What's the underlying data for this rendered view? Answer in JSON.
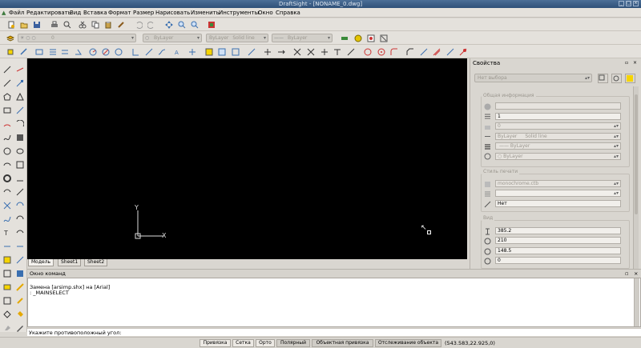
{
  "window": {
    "title": "DraftSight - [NONAME_0.dwg]"
  },
  "menu": [
    "Файл",
    "Редактировать",
    "Вид",
    "Вставка",
    "Формат",
    "Размер",
    "Нарисовать",
    "Изменить",
    "Инструменты",
    "Окно",
    "Справка"
  ],
  "layer_toolbar": {
    "layer_value": "0",
    "color_value": "ByLayer",
    "linestyle_value": "ByLayer",
    "linestyle_name": "Solid line",
    "lineweight_value": "ByLayer"
  },
  "canvas": {
    "ucs_x_label": "X",
    "ucs_y_label": "Y"
  },
  "tabs": [
    "Модель",
    "Sheet1",
    "Sheet2"
  ],
  "command_window": {
    "header": "Окно команд",
    "lines": [
      "Замена [arsimp.shx] на [Arial]",
      ": _MAINSELECT"
    ],
    "prompt": "Укажите противоположный угол:"
  },
  "properties": {
    "title": "Свойства",
    "selection": "Нет выбора",
    "groups": {
      "general": "Общая информация",
      "print_style": "Стиль печати",
      "view": "Вид"
    },
    "general_fields": [
      "",
      "1",
      "0",
      "ByLayer",
      "ByLayer",
      "ByLayer"
    ],
    "linestyle_sample": "Solid line",
    "print_fields": [
      "monochrome.ctb",
      "",
      "Нет"
    ],
    "view_fields": [
      "385.2",
      "210",
      "148.5",
      "0"
    ]
  },
  "status_bar": {
    "buttons": [
      "Привязка",
      "Сетка",
      "Орто",
      "Полярный",
      "Объектная привязка",
      "Отслеживание объекта"
    ],
    "coords": "(543.583,22.925,0)"
  }
}
